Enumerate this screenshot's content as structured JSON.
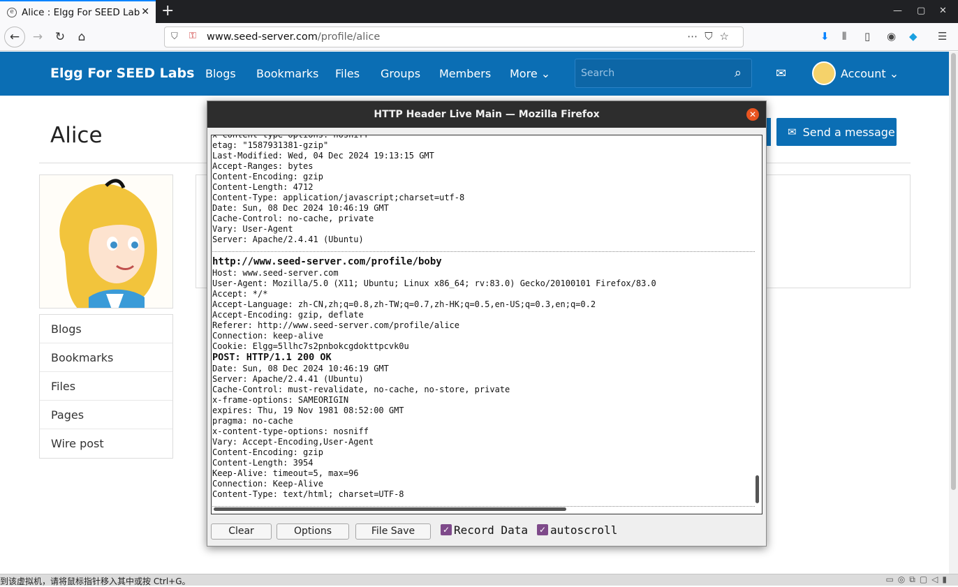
{
  "browser": {
    "tab_title": "Alice : Elgg For SEED Labs",
    "url_host": "www.seed-server.com",
    "url_path": "/profile/alice"
  },
  "elgg": {
    "brand": "Elgg For SEED Labs",
    "menu": [
      "Blogs",
      "Bookmarks",
      "Files",
      "Groups",
      "Members",
      "More ⌄"
    ],
    "search_placeholder": "Search",
    "account": "Account ⌄",
    "profile_name": "Alice",
    "send_message": "Send a message",
    "side_menu": [
      "Blogs",
      "Bookmarks",
      "Files",
      "Pages",
      "Wire post"
    ]
  },
  "popup": {
    "title": "HTTP Header Live Main — Mozilla Firefox",
    "block1": [
      "x-content-type-options: nosniff",
      "etag: \"1587931381-gzip\"",
      "Last-Modified: Wed, 04 Dec 2024 19:13:15 GMT",
      "Accept-Ranges: bytes",
      "Content-Encoding: gzip",
      "Content-Length: 4712",
      "Content-Type: application/javascript;charset=utf-8",
      "Date: Sun, 08 Dec 2024 10:46:19 GMT",
      "Cache-Control: no-cache, private",
      "Vary: User-Agent",
      "Server: Apache/2.4.41 (Ubuntu)"
    ],
    "request_url": "http://www.seed-server.com/profile/boby",
    "request_headers": [
      "Host: www.seed-server.com",
      "User-Agent: Mozilla/5.0 (X11; Ubuntu; Linux x86_64; rv:83.0) Gecko/20100101 Firefox/83.0",
      "Accept: */*",
      "Accept-Language: zh-CN,zh;q=0.8,zh-TW;q=0.7,zh-HK;q=0.5,en-US;q=0.3,en;q=0.2",
      "Accept-Encoding: gzip, deflate",
      "Referer: http://www.seed-server.com/profile/alice",
      "Connection: keep-alive",
      "Cookie: Elgg=5llhc7s2pnbokcgdokttpcvk0u"
    ],
    "response_status": "POST: HTTP/1.1 200 OK",
    "response_headers": [
      "Date: Sun, 08 Dec 2024 10:46:19 GMT",
      "Server: Apache/2.4.41 (Ubuntu)",
      "Cache-Control: must-revalidate, no-cache, no-store, private",
      "x-frame-options: SAMEORIGIN",
      "expires: Thu, 19 Nov 1981 08:52:00 GMT",
      "pragma: no-cache",
      "x-content-type-options: nosniff",
      "Vary: Accept-Encoding,User-Agent",
      "Content-Encoding: gzip",
      "Content-Length: 3954",
      "Keep-Alive: timeout=5, max=96",
      "Connection: Keep-Alive",
      "Content-Type: text/html; charset=UTF-8"
    ],
    "buttons": {
      "clear": "Clear",
      "options": "Options",
      "file_save": "File Save"
    },
    "record_data_label": "Record Data",
    "record_data_checked": true,
    "autoscroll_label": "autoscroll",
    "autoscroll_checked": true
  },
  "statusbar": {
    "text": "到该虚拟机，请将鼠标指针移入其中或按 Ctrl+G。"
  }
}
